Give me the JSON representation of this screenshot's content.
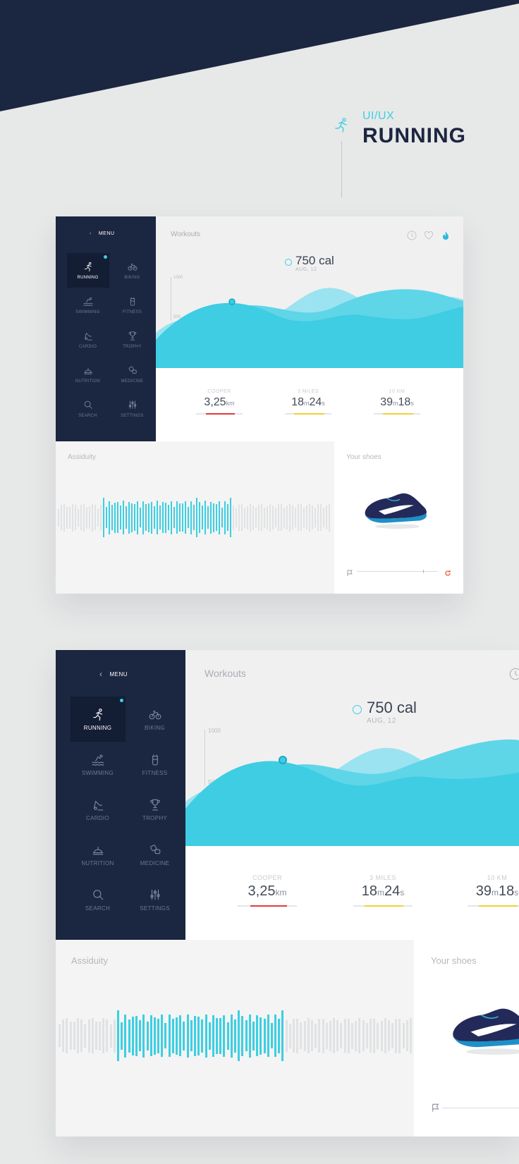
{
  "hero": {
    "subtitle": "UI/UX",
    "title": "RUNNING"
  },
  "colors": {
    "navy": "#1b2640",
    "accent": "#3ccfe2",
    "red": "#e23a3a",
    "yellow": "#f5cf35",
    "flame": "#2fb8e0"
  },
  "screens": [
    {
      "menu_label": "MENU",
      "nav": [
        {
          "label": "RUNNING",
          "icon": "running-icon",
          "active": true
        },
        {
          "label": "BIKING",
          "icon": "bike-icon"
        },
        {
          "label": "SWIMMING",
          "icon": "swimming-icon"
        },
        {
          "label": "FITNESS",
          "icon": "fitness-icon"
        },
        {
          "label": "CARDIO",
          "icon": "cardio-icon"
        },
        {
          "label": "TROPHY",
          "icon": "trophy-icon"
        },
        {
          "label": "NUTRITION",
          "icon": "nutrition-icon"
        },
        {
          "label": "MEDICINE",
          "icon": "medicine-icon"
        },
        {
          "label": "SEARCH",
          "icon": "search-icon"
        },
        {
          "label": "SETTINGS",
          "icon": "settings-icon"
        }
      ],
      "workouts": {
        "title": "Workouts",
        "calories": "750 cal",
        "date": "AUG, 12",
        "y_ticks": [
          "1000",
          "500"
        ],
        "header_icons": [
          "clock-icon",
          "heart-icon",
          "flame-icon"
        ]
      },
      "stats": [
        {
          "label": "COOPER",
          "value": "3,25",
          "unit": "km",
          "progress": 0.62,
          "color": "#e23a3a"
        },
        {
          "label": "3 MILES",
          "value_a": "18",
          "unit_a": "m",
          "value_b": "24",
          "unit_b": "s",
          "progress": 0.65,
          "color": "#f5cf35"
        },
        {
          "label": "10 KM",
          "value_a": "39",
          "unit_a": "m",
          "value_b": "18",
          "unit_b": "s",
          "progress": 0.65,
          "color": "#f5cf35"
        }
      ],
      "assiduity": {
        "title": "Assiduity"
      },
      "shoes": {
        "title": "Your shoes",
        "progress": 0.82
      }
    },
    {
      "menu_label": "MENU",
      "nav": [
        {
          "label": "RUNNING",
          "icon": "running-icon",
          "active": true
        },
        {
          "label": "BIKING",
          "icon": "bike-icon"
        },
        {
          "label": "SWIMMING",
          "icon": "swimming-icon"
        },
        {
          "label": "FITNESS",
          "icon": "fitness-icon"
        },
        {
          "label": "CARDIO",
          "icon": "cardio-icon"
        },
        {
          "label": "TROPHY",
          "icon": "trophy-icon"
        },
        {
          "label": "NUTRITION",
          "icon": "nutrition-icon"
        },
        {
          "label": "MEDICINE",
          "icon": "medicine-icon"
        },
        {
          "label": "SEARCH",
          "icon": "search-icon"
        },
        {
          "label": "SETTINGS",
          "icon": "settings-icon"
        }
      ],
      "workouts": {
        "title": "Workouts",
        "calories": "750 cal",
        "date": "AUG, 12",
        "y_ticks": [
          "1000",
          "500"
        ],
        "header_icons": [
          "clock-icon"
        ]
      },
      "stats": [
        {
          "label": "COOPER",
          "value": "3,25",
          "unit": "km",
          "progress": 0.62,
          "color": "#e23a3a"
        },
        {
          "label": "3 MILES",
          "value_a": "18",
          "unit_a": "m",
          "value_b": "24",
          "unit_b": "s",
          "progress": 0.65,
          "color": "#f5cf35"
        },
        {
          "label": "10 KM",
          "value_a": "39",
          "unit_a": "m",
          "value_b": "18",
          "unit_b": "s",
          "progress": 0.65,
          "color": "#f5cf35"
        }
      ],
      "assiduity": {
        "title": "Assiduity"
      },
      "shoes": {
        "title": "Your shoes"
      }
    }
  ]
}
